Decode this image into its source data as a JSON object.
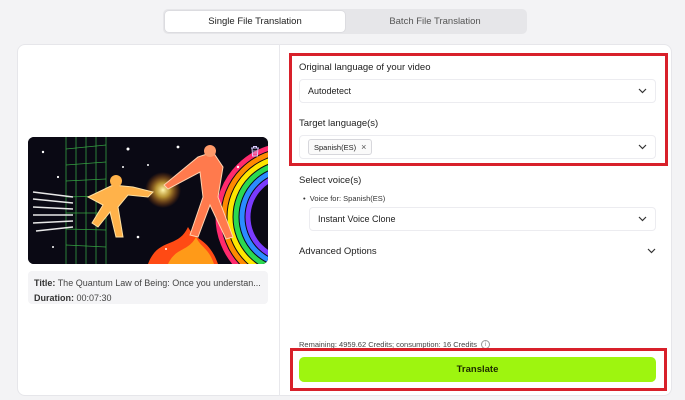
{
  "tabs": [
    {
      "label": "Single File Translation",
      "active": true
    },
    {
      "label": "Batch File Translation",
      "active": false
    }
  ],
  "video": {
    "title_label": "Title:",
    "title_value": "The Quantum Law of Being: Once you understan...",
    "duration_label": "Duration:",
    "duration_value": "00:07:30"
  },
  "form": {
    "original_language_label": "Original language of your video",
    "original_language_value": "Autodetect",
    "target_language_label": "Target language(s)",
    "target_language_chip": "Spanish(ES)",
    "select_voice_label": "Select voice(s)",
    "voice_for_label": "Voice for: Spanish(ES)",
    "voice_value": "Instant Voice Clone",
    "advanced_label": "Advanced Options"
  },
  "footer": {
    "credits_text": "Remaining: 4959.62 Credits; consumption: 16 Credits",
    "translate_label": "Translate"
  },
  "colors": {
    "accent": "#9ef50f",
    "highlight": "#d8202a"
  }
}
